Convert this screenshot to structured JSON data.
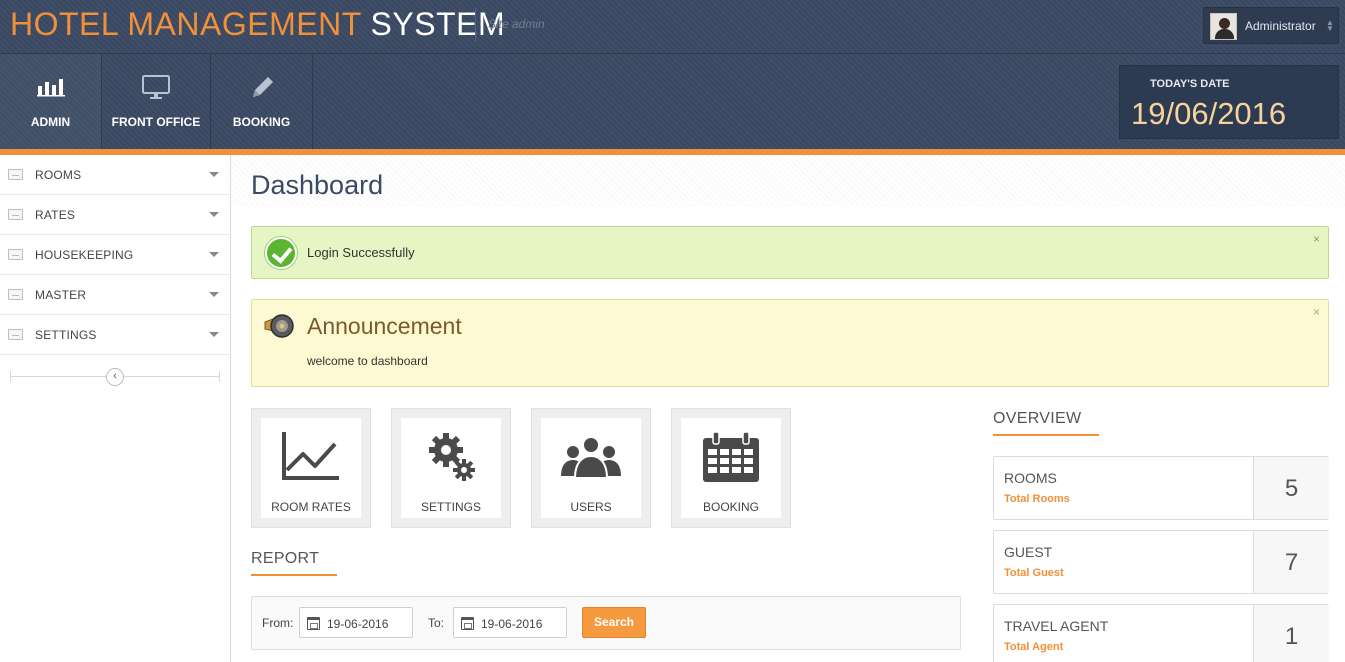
{
  "header": {
    "brand_part1": "HOTEL MANAGEMENT",
    "brand_part2": "SYSTEM",
    "site_admin": "Site admin",
    "user_name": "Administrator"
  },
  "nav": {
    "items": [
      {
        "label": "ADMIN",
        "icon": "bar-chart-icon"
      },
      {
        "label": "FRONT OFFICE",
        "icon": "monitor-icon"
      },
      {
        "label": "BOOKING",
        "icon": "pencil-icon"
      }
    ],
    "active": "ADMIN"
  },
  "date_box": {
    "label": "TODAY'S DATE",
    "value": "19/06/2016"
  },
  "sidebar": {
    "items": [
      {
        "label": "ROOMS"
      },
      {
        "label": "RATES"
      },
      {
        "label": "HOUSEKEEPING"
      },
      {
        "label": "MASTER"
      },
      {
        "label": "SETTINGS"
      }
    ],
    "collapse_glyph": "‹"
  },
  "main": {
    "title": "Dashboard",
    "success_alert": {
      "text": "Login Successfully",
      "close": "×"
    },
    "announcement": {
      "title": "Announcement",
      "text": "welcome to dashboard",
      "close": "×"
    },
    "tiles": [
      {
        "label": "ROOM RATES",
        "icon": "line-chart-icon"
      },
      {
        "label": "SETTINGS",
        "icon": "gears-icon"
      },
      {
        "label": "USERS",
        "icon": "users-group-icon"
      },
      {
        "label": "BOOKING",
        "icon": "calendar-icon"
      }
    ],
    "report": {
      "title": "REPORT",
      "from_label": "From:",
      "from_value": "19-06-2016",
      "to_label": "To:",
      "to_value": "19-06-2016",
      "search_label": "Search"
    },
    "overview": {
      "title": "OVERVIEW",
      "cards": [
        {
          "name": "ROOMS",
          "sub": "Total Rooms",
          "count": "5"
        },
        {
          "name": "GUEST",
          "sub": "Total Guest",
          "count": "7"
        },
        {
          "name": "TRAVEL AGENT",
          "sub": "Total Agent",
          "count": "1"
        }
      ]
    }
  },
  "colors": {
    "accent": "#f0913a",
    "header_bg": "#3b4a63",
    "success_bg": "#e6f5c4",
    "announce_bg": "#fdf9d2",
    "date_value": "#f6d39a"
  }
}
